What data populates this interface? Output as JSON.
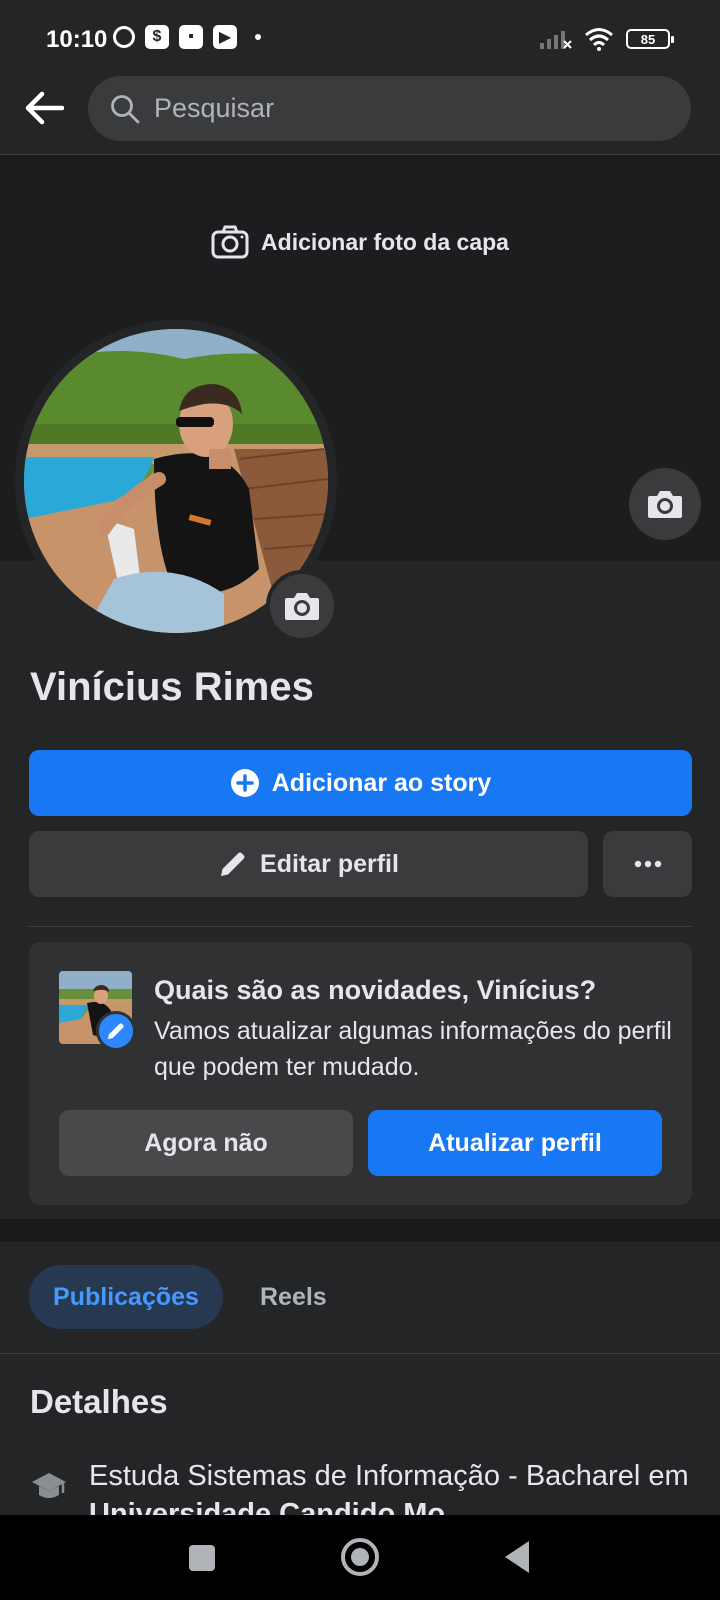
{
  "status_bar": {
    "time": "10:10",
    "battery": "85",
    "icons": [
      "alarm-icon",
      "dollar-icon",
      "chat-icon",
      "youtube-icon",
      "signal-icon",
      "wifi-icon",
      "battery-icon"
    ]
  },
  "header": {
    "search_placeholder": "Pesquisar"
  },
  "cover": {
    "add_cover_label": "Adicionar foto da capa"
  },
  "profile": {
    "name": "Vinícius Rimes"
  },
  "actions": {
    "add_story": "Adicionar ao story",
    "edit_profile": "Editar perfil"
  },
  "prompt_card": {
    "title": "Quais são as novidades, Vinícius?",
    "description": "Vamos atualizar algumas informações do perfil que podem ter mudado.",
    "dismiss_label": "Agora não",
    "update_label": "Atualizar perfil"
  },
  "tabs": [
    {
      "label": "Publicações",
      "active": true
    },
    {
      "label": "Reels",
      "active": false
    }
  ],
  "details": {
    "title": "Detalhes",
    "education_prefix": "Estuda Sistemas de Informação - Bacharel em ",
    "education_school": "Universidade Candido Mo..."
  },
  "colors": {
    "accent": "#1877f2",
    "background": "#242526",
    "cover": "#1c1d1e",
    "card": "#303132"
  }
}
